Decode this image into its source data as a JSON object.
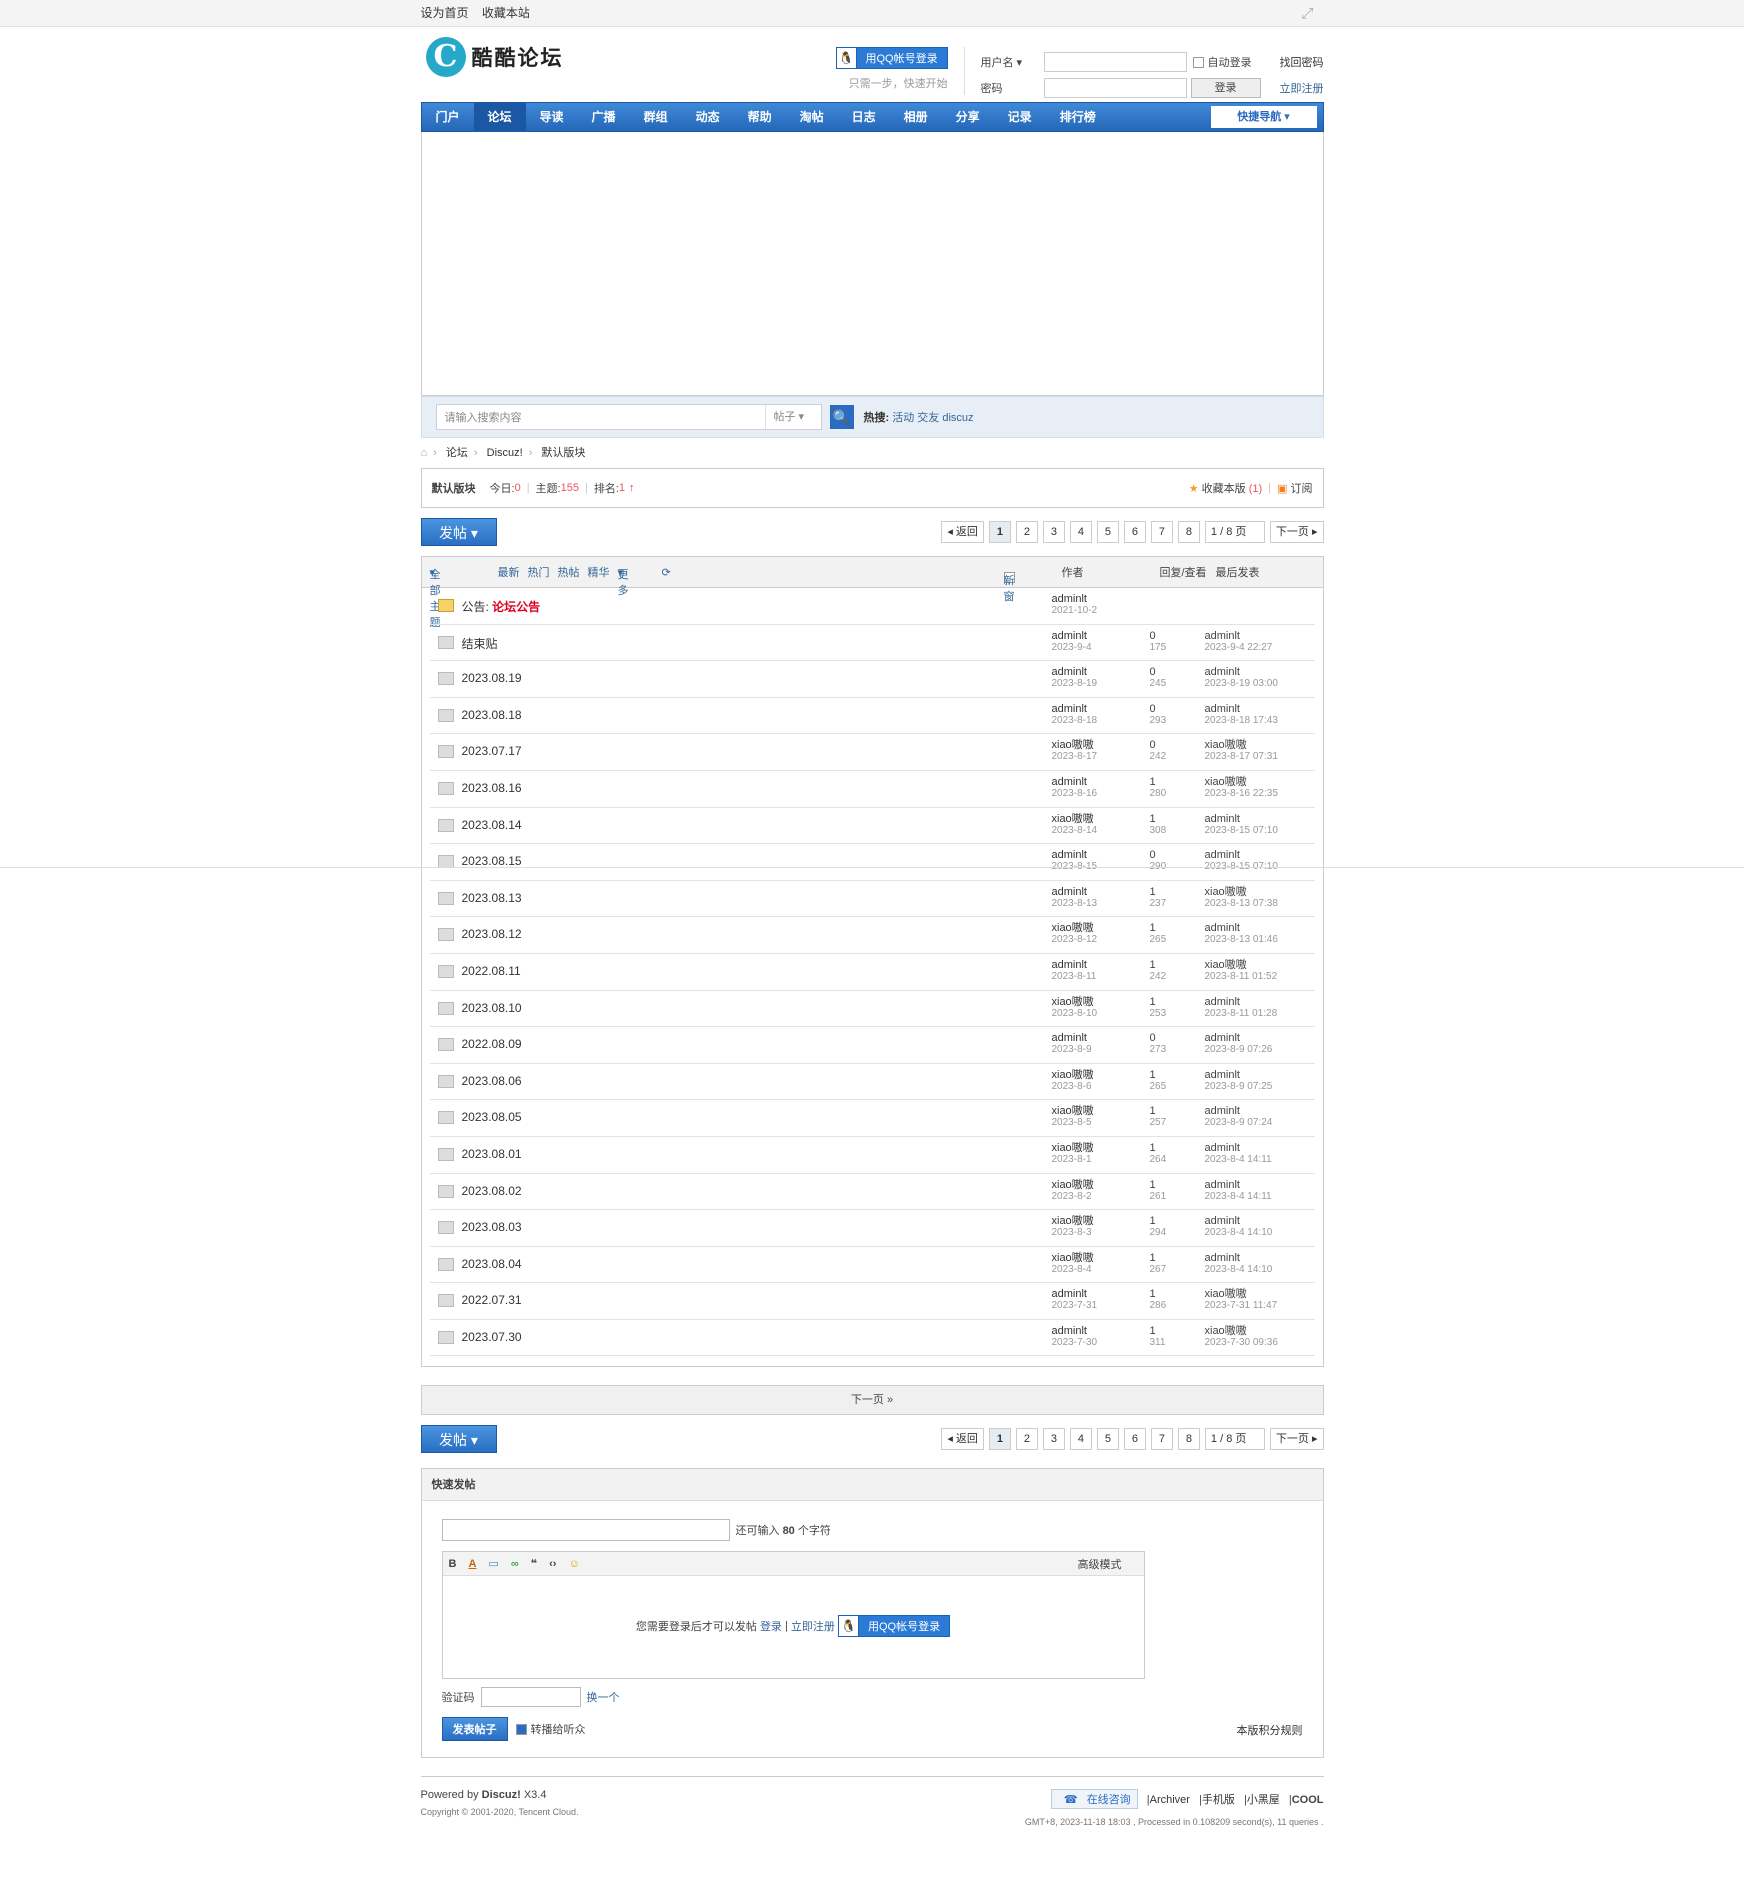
{
  "topbar": {
    "set_home": "设为首页",
    "bookmark": "收藏本站"
  },
  "logo": {
    "text": "酷酷论坛",
    "mark": "C"
  },
  "qq": {
    "button": "用QQ帐号登录",
    "tip": "只需一步，快速开始"
  },
  "login": {
    "username_label": "用户名",
    "password_label": "密码",
    "auto_login": "自动登录",
    "login_button": "登录",
    "forgot": "找回密码",
    "register": "立即注册"
  },
  "nav": {
    "items": [
      "门户",
      "论坛",
      "导读",
      "广播",
      "群组",
      "动态",
      "帮助",
      "淘帖",
      "日志",
      "相册",
      "分享",
      "记录",
      "排行榜"
    ],
    "active_index": 1,
    "quick": "快捷导航"
  },
  "search": {
    "placeholder": "请输入搜索内容",
    "type": "帖子",
    "hot_label": "热搜:",
    "hot": [
      "活动",
      "交友",
      "discuz"
    ]
  },
  "breadcrumb": [
    "论坛",
    "Discuz!",
    "默认版块"
  ],
  "forum": {
    "name": "默认版块",
    "today_label": "今日:",
    "today": "0",
    "topics_label": "主题:",
    "topics": "155",
    "rank_label": "排名:",
    "rank": "1",
    "fav": "收藏本版",
    "fav_count": "(1)",
    "subscribe": "订阅"
  },
  "post_button": "发帖",
  "pager": {
    "back": "返回",
    "pages": [
      "1",
      "2",
      "3",
      "4",
      "5",
      "6",
      "7",
      "8"
    ],
    "current": "1",
    "total": "/ 8 页",
    "next": "下一页"
  },
  "thead": {
    "all": "全部主题",
    "latest": "最新",
    "hot": "热门",
    "hotpost": "热帖",
    "digest": "精华",
    "more": "更多",
    "newwin": "新窗",
    "author": "作者",
    "replies": "回复/查看",
    "last": "最后发表"
  },
  "threads": [
    {
      "title": "公告: ",
      "title_red": "论坛公告",
      "author": "adminlt",
      "date": "2021-10-2",
      "replies": "",
      "views": "",
      "last_user": "",
      "last_time": "",
      "ann": true
    },
    {
      "title": "结束贴",
      "author": "adminlt",
      "date": "2023-9-4",
      "replies": "0",
      "views": "175",
      "last_user": "adminlt",
      "last_time": "2023-9-4 22:27"
    },
    {
      "title": "2023.08.19",
      "author": "adminlt",
      "date": "2023-8-19",
      "replies": "0",
      "views": "245",
      "last_user": "adminlt",
      "last_time": "2023-8-19 03:00"
    },
    {
      "title": "2023.08.18",
      "author": "adminlt",
      "date": "2023-8-18",
      "replies": "0",
      "views": "293",
      "last_user": "adminlt",
      "last_time": "2023-8-18 17:43"
    },
    {
      "title": "2023.07.17",
      "author": "xiao嗷嗷",
      "date": "2023-8-17",
      "replies": "0",
      "views": "242",
      "last_user": "xiao嗷嗷",
      "last_time": "2023-8-17 07:31"
    },
    {
      "title": "2023.08.16",
      "author": "adminlt",
      "date": "2023-8-16",
      "replies": "1",
      "views": "280",
      "last_user": "xiao嗷嗷",
      "last_time": "2023-8-16 22:35"
    },
    {
      "title": "2023.08.14",
      "author": "xiao嗷嗷",
      "date": "2023-8-14",
      "replies": "1",
      "views": "308",
      "last_user": "adminlt",
      "last_time": "2023-8-15 07:10"
    },
    {
      "title": "2023.08.15",
      "author": "adminlt",
      "date": "2023-8-15",
      "replies": "0",
      "views": "290",
      "last_user": "adminlt",
      "last_time": "2023-8-15 07:10"
    },
    {
      "title": "2023.08.13",
      "author": "adminlt",
      "date": "2023-8-13",
      "replies": "1",
      "views": "237",
      "last_user": "xiao嗷嗷",
      "last_time": "2023-8-13 07:38"
    },
    {
      "title": "2023.08.12",
      "author": "xiao嗷嗷",
      "date": "2023-8-12",
      "replies": "1",
      "views": "265",
      "last_user": "adminlt",
      "last_time": "2023-8-13 01:46"
    },
    {
      "title": "2022.08.11",
      "author": "adminlt",
      "date": "2023-8-11",
      "replies": "1",
      "views": "242",
      "last_user": "xiao嗷嗷",
      "last_time": "2023-8-11 01:52"
    },
    {
      "title": "2023.08.10",
      "author": "xiao嗷嗷",
      "date": "2023-8-10",
      "replies": "1",
      "views": "253",
      "last_user": "adminlt",
      "last_time": "2023-8-11 01:28"
    },
    {
      "title": "2022.08.09",
      "author": "adminlt",
      "date": "2023-8-9",
      "replies": "0",
      "views": "273",
      "last_user": "adminlt",
      "last_time": "2023-8-9 07:26"
    },
    {
      "title": "2023.08.06",
      "author": "xiao嗷嗷",
      "date": "2023-8-6",
      "replies": "1",
      "views": "265",
      "last_user": "adminlt",
      "last_time": "2023-8-9 07:25"
    },
    {
      "title": "2023.08.05",
      "author": "xiao嗷嗷",
      "date": "2023-8-5",
      "replies": "1",
      "views": "257",
      "last_user": "adminlt",
      "last_time": "2023-8-9 07:24"
    },
    {
      "title": "2023.08.01",
      "author": "xiao嗷嗷",
      "date": "2023-8-1",
      "replies": "1",
      "views": "264",
      "last_user": "adminlt",
      "last_time": "2023-8-4 14:11"
    },
    {
      "title": "2023.08.02",
      "author": "xiao嗷嗷",
      "date": "2023-8-2",
      "replies": "1",
      "views": "261",
      "last_user": "adminlt",
      "last_time": "2023-8-4 14:11"
    },
    {
      "title": "2023.08.03",
      "author": "xiao嗷嗷",
      "date": "2023-8-3",
      "replies": "1",
      "views": "294",
      "last_user": "adminlt",
      "last_time": "2023-8-4 14:10"
    },
    {
      "title": "2023.08.04",
      "author": "xiao嗷嗷",
      "date": "2023-8-4",
      "replies": "1",
      "views": "267",
      "last_user": "adminlt",
      "last_time": "2023-8-4 14:10"
    },
    {
      "title": "2022.07.31",
      "author": "adminlt",
      "date": "2023-7-31",
      "replies": "1",
      "views": "286",
      "last_user": "xiao嗷嗷",
      "last_time": "2023-7-31 11:47"
    },
    {
      "title": "2023.07.30",
      "author": "adminlt",
      "date": "2023-7-30",
      "replies": "1",
      "views": "311",
      "last_user": "xiao嗷嗷",
      "last_time": "2023-7-30 09:36"
    }
  ],
  "next_bar": "下一页 »",
  "fast": {
    "title": "快速发帖",
    "remain_pre": "还可输入",
    "remain_num": "80",
    "remain_post": "个字符",
    "advanced": "高级模式",
    "need_login": "您需要登录后才可以发帖",
    "login": "登录",
    "register": "立即注册",
    "captcha": "验证码",
    "change": "换一个",
    "submit": "发表帖子",
    "broadcast": "转播给听众",
    "rules": "本版积分规则"
  },
  "footer": {
    "powered": "Powered by",
    "discuz": "Discuz!",
    "ver": "X3.4",
    "copyright": "Copyright © 2001-2020, Tencent Cloud.",
    "consult": "在线咨询",
    "links": [
      "Archiver",
      "手机版",
      "小黑屋"
    ],
    "cool": "COOL",
    "gmt": "GMT+8, 2023-11-18 18:03 , Processed in 0.108209 second(s), 11 queries ."
  }
}
